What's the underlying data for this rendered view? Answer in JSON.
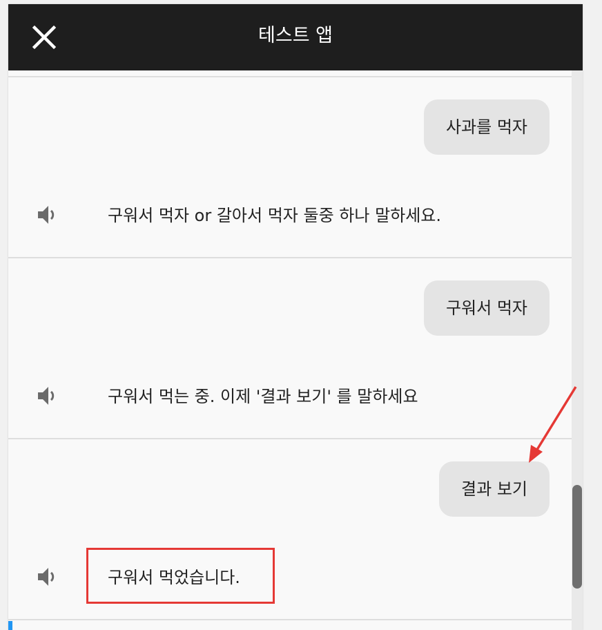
{
  "app": {
    "title": "테스트 앱"
  },
  "icons": {
    "close": "close-icon",
    "speaker": "speaker-icon"
  },
  "colors": {
    "topbar": "#1e1e1e",
    "bubble": "#e4e4e4",
    "annotation": "#e53935"
  },
  "turns": [
    {
      "user": "사과를 먹자",
      "response": "구워서 먹자 or 갈아서 먹자 둘중 하나 말하세요."
    },
    {
      "user": "구워서 먹자",
      "response": "구워서 먹는 중. 이제 '결과 보기' 를 말하세요"
    },
    {
      "user": "결과 보기",
      "response": "구워서 먹었습니다."
    }
  ]
}
